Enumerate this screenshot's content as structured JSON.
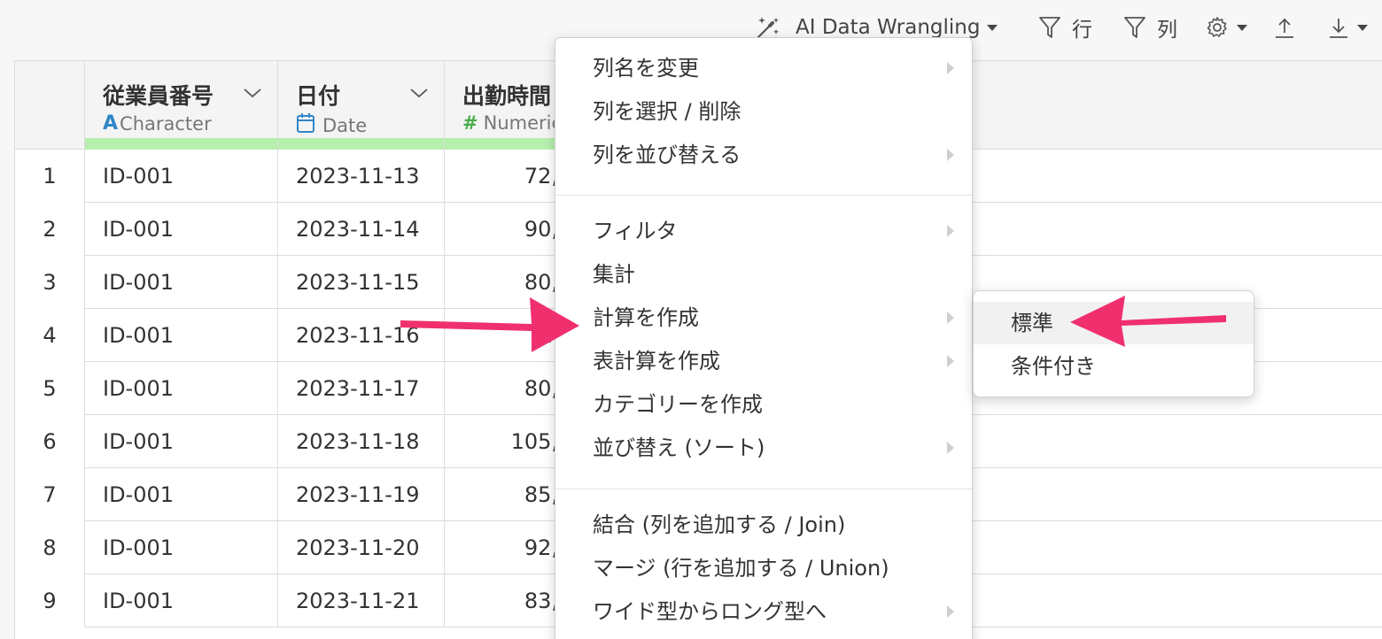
{
  "toolbar": {
    "ai_label": "AI Data Wrangling",
    "row_filter_label": "行",
    "col_filter_label": "列"
  },
  "columns": [
    {
      "name": "従業員番号",
      "type": "Character",
      "type_icon": "character-type-icon"
    },
    {
      "name": "日付",
      "type": "Date",
      "type_icon": "calendar-icon"
    },
    {
      "name": "出勤時間",
      "type": "Numeric",
      "type_icon": "hash-icon"
    }
  ],
  "rows": [
    {
      "idx": "1",
      "id": "ID-001",
      "date": "2023-11-13",
      "num": "72,"
    },
    {
      "idx": "2",
      "id": "ID-001",
      "date": "2023-11-14",
      "num": "90,"
    },
    {
      "idx": "3",
      "id": "ID-001",
      "date": "2023-11-15",
      "num": "80,"
    },
    {
      "idx": "4",
      "id": "ID-001",
      "date": "2023-11-16",
      "num": "7"
    },
    {
      "idx": "5",
      "id": "ID-001",
      "date": "2023-11-17",
      "num": "80,"
    },
    {
      "idx": "6",
      "id": "ID-001",
      "date": "2023-11-18",
      "num": "105,"
    },
    {
      "idx": "7",
      "id": "ID-001",
      "date": "2023-11-19",
      "num": "85,"
    },
    {
      "idx": "8",
      "id": "ID-001",
      "date": "2023-11-20",
      "num": "92,"
    },
    {
      "idx": "9",
      "id": "ID-001",
      "date": "2023-11-21",
      "num": "83,"
    }
  ],
  "menu": {
    "items": [
      {
        "label": "列名を変更",
        "submenu": true
      },
      {
        "label": "列を選択 / 削除",
        "submenu": false
      },
      {
        "label": "列を並び替える",
        "submenu": true
      },
      {
        "label": "フィルタ",
        "submenu": true
      },
      {
        "label": "集計",
        "submenu": false
      },
      {
        "label": "計算を作成",
        "submenu": true
      },
      {
        "label": "表計算を作成",
        "submenu": true
      },
      {
        "label": "カテゴリーを作成",
        "submenu": false
      },
      {
        "label": "並び替え (ソート)",
        "submenu": true
      },
      {
        "label": "結合 (列を追加する / Join)",
        "submenu": false
      },
      {
        "label": "マージ (行を追加する / Union)",
        "submenu": false
      },
      {
        "label": "ワイド型からロング型へ",
        "submenu": true
      }
    ]
  },
  "submenu": {
    "items": [
      {
        "label": "標準",
        "highlighted": true
      },
      {
        "label": "条件付き",
        "highlighted": false
      }
    ]
  },
  "colors": {
    "annotation_arrow": "#f0306e",
    "quality_bar": "#b7f0ae",
    "character_icon": "#2f86c9",
    "numeric_icon": "#4aae4a"
  }
}
